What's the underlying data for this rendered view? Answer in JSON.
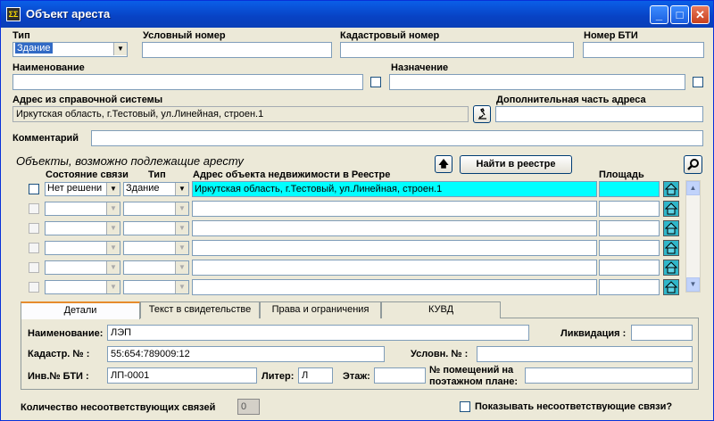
{
  "window": {
    "title": "Объект ареста",
    "icon_text": "ΣΣ"
  },
  "top": {
    "type_label": "Тип",
    "type_value": "Здание",
    "cond_label": "Условный номер",
    "cad_label": "Кадастровый номер",
    "bti_label": "Номер БТИ",
    "name_label": "Наименование",
    "purpose_label": "Назначение",
    "address_label": "Адрес из справочной системы",
    "address_value": "Иркутская область, г.Тестовый, ул.Линейная, строен.1",
    "extra_address_label": "Дополнительная часть адреса",
    "comment_label": "Комментарий"
  },
  "objects": {
    "title": "Объекты, возможно подлежащие аресту",
    "find_button": "Найти в реестре",
    "columns": {
      "state": "Состояние связи",
      "type": "Тип",
      "address": "Адрес объекта недвижимости в Реестре",
      "area": "Площадь"
    },
    "rows": [
      {
        "state": "Нет решени",
        "type": "Здание",
        "address": "Иркутская область, г.Тестовый, ул.Линейная, строен.1",
        "area": ""
      },
      {
        "state": "",
        "type": "",
        "address": "",
        "area": ""
      },
      {
        "state": "",
        "type": "",
        "address": "",
        "area": ""
      },
      {
        "state": "",
        "type": "",
        "address": "",
        "area": ""
      },
      {
        "state": "",
        "type": "",
        "address": "",
        "area": ""
      },
      {
        "state": "",
        "type": "",
        "address": "",
        "area": ""
      }
    ]
  },
  "tabs": [
    "Детали",
    "Текст в свидетельстве",
    "Права и ограничения",
    "КУВД"
  ],
  "details": {
    "name_label": "Наименование:",
    "name_value": "ЛЭП",
    "liq_label": "Ликвидация :",
    "cad_label": "Кадастр. № :",
    "cad_value": "55:654:789009:12",
    "cond_label": "Условн. № :",
    "bti_label": "Инв.№ БТИ :",
    "bti_value": "ЛП-0001",
    "liter_label": "Литер:",
    "liter_value": "Л",
    "floor_label": "Этаж:",
    "rooms_label": "№ помещений на поэтажном плане:"
  },
  "footer": {
    "mismatch_label": "Количество несоответствующих связей",
    "mismatch_value": "0",
    "show_label": "Показывать несоответствующие связи?"
  },
  "colors": {
    "highlight_row": "#00ffff",
    "title_bar": "#0842c4",
    "tab_accent": "#e68b2c"
  }
}
